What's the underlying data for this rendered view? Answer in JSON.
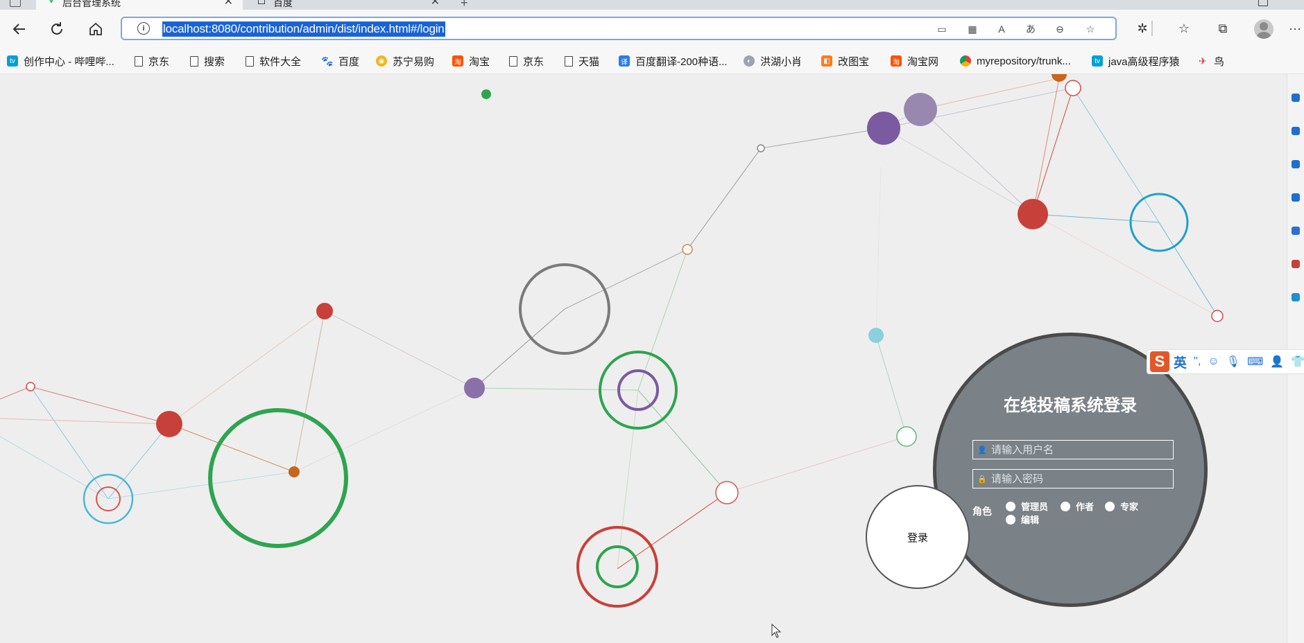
{
  "browser": {
    "tabs": [
      {
        "label": "后台管理系统",
        "active": true
      },
      {
        "label": "百度",
        "active": false
      }
    ],
    "new_tab_label": "+",
    "address": {
      "url": "localhost:8080/contribution/admin/dist/index.html#/login"
    },
    "bookmarks": [
      {
        "label": "创作中心 - 哔哩哔...",
        "icon": "bilibili-icon"
      },
      {
        "label": "京东",
        "icon": "page-icon"
      },
      {
        "label": "搜索",
        "icon": "page-icon"
      },
      {
        "label": "软件大全",
        "icon": "page-icon"
      },
      {
        "label": "百度",
        "icon": "baidu-icon"
      },
      {
        "label": "苏宁易购",
        "icon": "suning-icon"
      },
      {
        "label": "淘宝",
        "icon": "taobao-icon"
      },
      {
        "label": "京东",
        "icon": "page-icon"
      },
      {
        "label": "天猫",
        "icon": "page-icon"
      },
      {
        "label": "百度翻译-200种语...",
        "icon": "baidu-translate-icon"
      },
      {
        "label": "洪湖小肖",
        "icon": "hongshu-icon"
      },
      {
        "label": "改图宝",
        "icon": "gaitubao-icon"
      },
      {
        "label": "淘宝网",
        "icon": "taobao-icon"
      },
      {
        "label": "myrepository/trunk...",
        "icon": "chrome-icon"
      },
      {
        "label": "java高级程序猿",
        "icon": "bilibili-icon"
      },
      {
        "label": "鸟",
        "icon": "bird-icon"
      }
    ],
    "more_label": "···"
  },
  "login": {
    "title": "在线投稿系统登录",
    "username_placeholder": "请输入用户名",
    "password_placeholder": "请输入密码",
    "role_label": "角色",
    "roles": [
      "管理员",
      "作者",
      "专家",
      "编辑"
    ],
    "submit_label": "登录"
  },
  "ime": {
    "logo": "S",
    "lang": "英",
    "punct": "'',"
  },
  "colors": {
    "panel": "#7a8288",
    "panel_border": "#4a4a4a",
    "url_highlight": "#1a63d6",
    "address_border": "#7aa7e6",
    "ime_brand": "#e2572a"
  }
}
